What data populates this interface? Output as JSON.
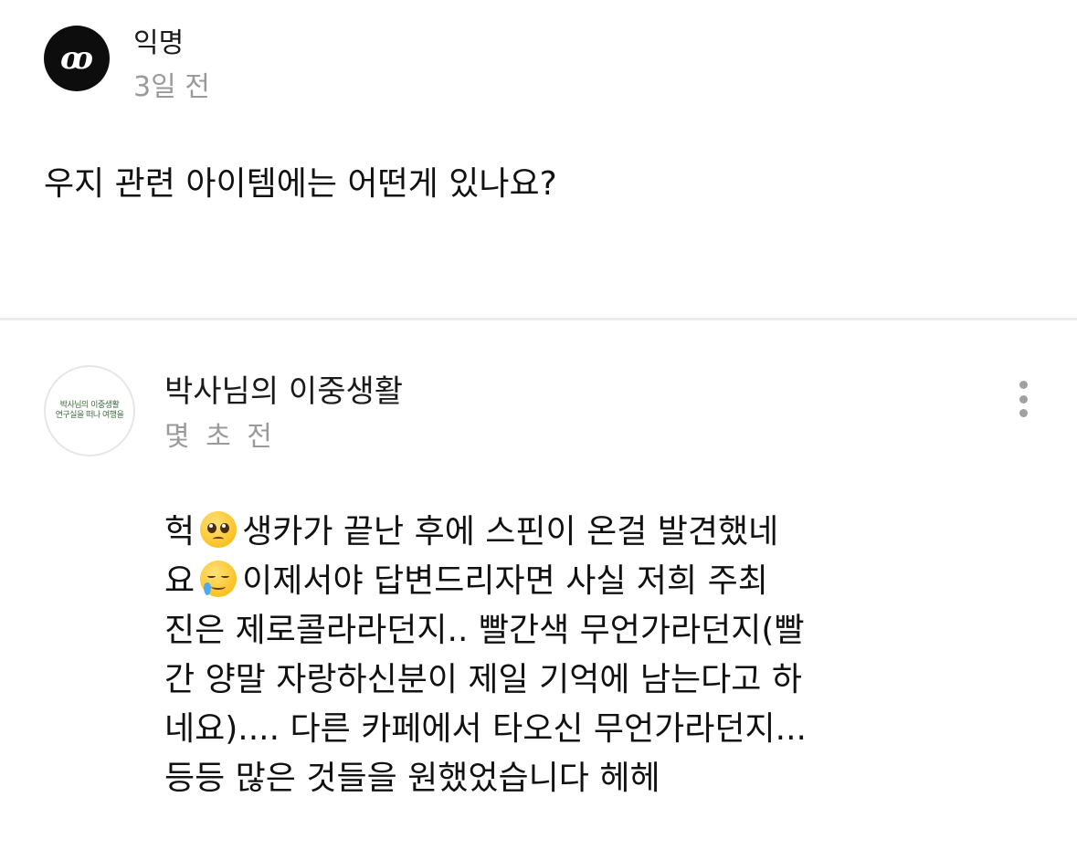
{
  "question": {
    "avatar_glyph": "ꝏ",
    "author": "익명",
    "time": "3일 전",
    "body": "우지 관련 아이템에는 어떤게 있나요?"
  },
  "answer": {
    "author": "박사님의 이중생활",
    "time": "몇 초 전",
    "avatar_logo": {
      "line1": "박사님의 이중생활",
      "line2": "연구실을 떠나 여행을"
    },
    "more_icon": "vertical-ellipsis-icon",
    "lines": {
      "l1a": "헉",
      "l1b": "생카가 끝난 후에 스핀이 온걸 발견했네",
      "l2a": "요",
      "l2b": "이제서야 답변드리자면 사실 저희 주최",
      "l3": "진은 제로콜라라던지.. 빨간색 무언가라던지(빨",
      "l4": "간 양말 자랑하신분이 제일 기억에 남는다고 하",
      "l5": "네요).... 다른 카페에서 타오신 무언가라던지...",
      "l6": "등등 많은 것들을 원했었습니다 헤헤"
    },
    "emojis": [
      "pleading-face-emoji",
      "smiling-face-with-tear-emoji"
    ]
  },
  "colors": {
    "text": "#111111",
    "muted": "#9a9a9a",
    "divider": "#ececec",
    "avatar_dark": "#0d0d0d"
  }
}
